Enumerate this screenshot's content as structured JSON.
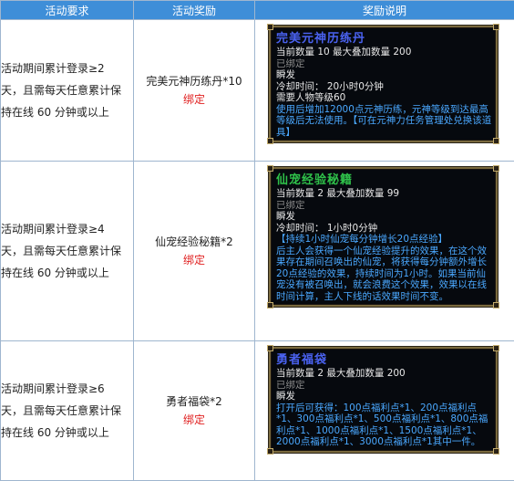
{
  "headers": [
    "活动要求",
    "活动奖励",
    "奖励说明"
  ],
  "rows": [
    {
      "requirement": [
        "活动期间累计登录≥2",
        "天，且需每天任意累计保",
        "持在线 60 分钟或以上"
      ],
      "reward_name": "完美元神历练丹*10",
      "reward_bind": "绑定",
      "tooltip": {
        "title": "完美元神历练丹",
        "title_color": "#4a62f0",
        "lines": [
          {
            "text": "当前数量 10 最大叠加数量 200",
            "style": "white"
          },
          {
            "text": "已绑定",
            "style": "gray"
          },
          {
            "text": "瞬发",
            "style": "white"
          },
          {
            "text": "冷却时间： 20小时0分钟",
            "style": "white"
          },
          {
            "text": "需要人物等级60",
            "style": "white"
          },
          {
            "text": "使用后增加12000点元神历练，元神等级到达最高等级后无法使用。【可在元神力任务管理处兑换该道具】",
            "style": "blue"
          }
        ]
      }
    },
    {
      "requirement": [
        "活动期间累计登录≥4",
        "天，且需每天任意累计保",
        "持在线 60 分钟或以上"
      ],
      "reward_name": "仙宠经验秘籍*2",
      "reward_bind": "绑定",
      "tooltip": {
        "title": "仙宠经验秘籍",
        "title_color": "#2fc24a",
        "lines": [
          {
            "text": "当前数量 2 最大叠加数量 99",
            "style": "white"
          },
          {
            "text": "已绑定",
            "style": "gray"
          },
          {
            "text": "瞬发",
            "style": "white"
          },
          {
            "text": "冷却时间： 1小时0分钟",
            "style": "white"
          },
          {
            "text": "【持续1小时仙宠每分钟增长20点经验】",
            "style": "blue"
          },
          {
            "text": "后主人会获得一个仙宠经验提升的效果，在这个效果存在期间召唤出的仙宠，将获得每分钟额外增长20点经验的效果，持续时间为1小时。如果当前仙宠没有被召唤出，就会浪费这个效果，效果以在线时间计算，主人下线的话效果时间不变。",
            "style": "blue"
          }
        ]
      }
    },
    {
      "requirement": [
        "活动期间累计登录≥6",
        "天，且需每天任意累计保",
        "持在线 60 分钟或以上"
      ],
      "reward_name": "勇者福袋*2",
      "reward_bind": "绑定",
      "tooltip": {
        "title": "勇者福袋",
        "title_color": "#4a62f0",
        "lines": [
          {
            "text": "当前数量 2 最大叠加数量 200",
            "style": "white"
          },
          {
            "text": "已绑定",
            "style": "gray"
          },
          {
            "text": "瞬发",
            "style": "white"
          },
          {
            "text": "打开后可获得：100点福利点*1、200点福利点*1、300点福利点*1、500点福利点*1、800点福利点*1、1000点福利点*1、1500点福利点*1、2000点福利点*1、3000点福利点*1其中一件。",
            "style": "blue"
          }
        ]
      }
    }
  ]
}
